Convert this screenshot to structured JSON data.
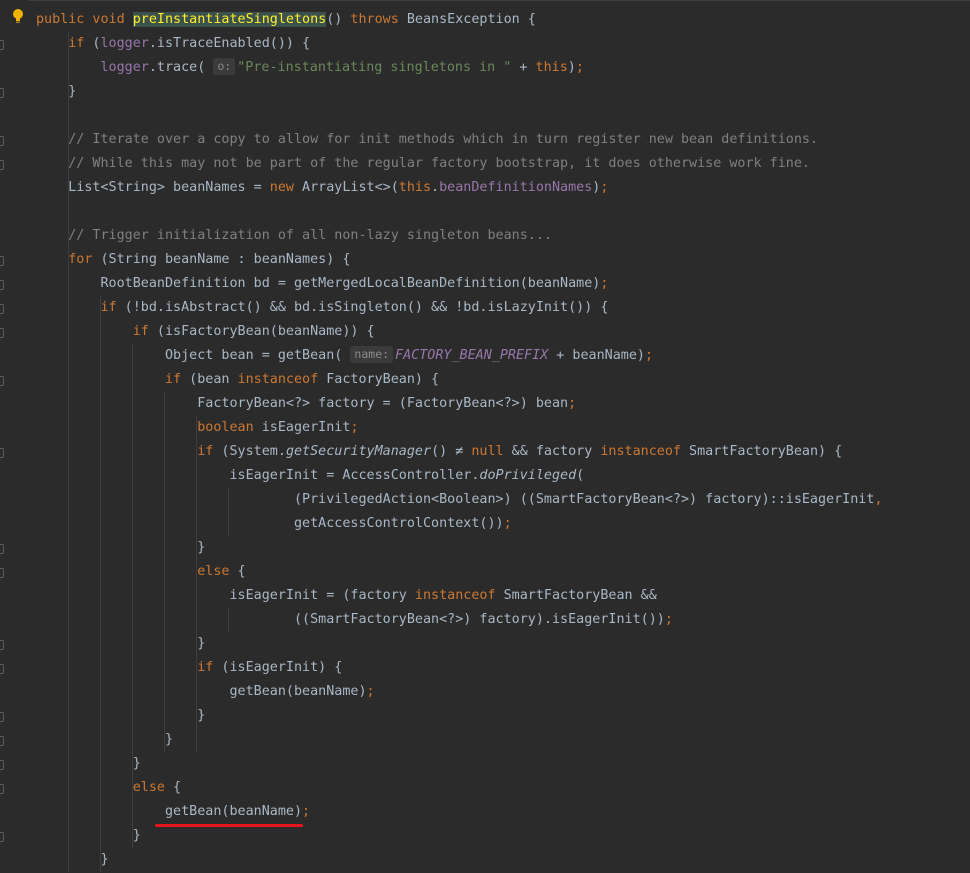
{
  "code_lines": [
    {
      "segments": [
        {
          "text": "public void ",
          "cls": "kw"
        },
        {
          "text": "preInstantiateSingletons",
          "cls": "fn hl"
        },
        {
          "text": "() "
        },
        {
          "text": "throws",
          "cls": "kw"
        },
        {
          "text": " BeansException {"
        }
      ]
    },
    {
      "segments": [
        {
          "text": "    "
        },
        {
          "text": "if",
          "cls": "kw"
        },
        {
          "text": " ("
        },
        {
          "text": "logger",
          "cls": "fld"
        },
        {
          "text": ".isTraceEnabled()) {"
        }
      ]
    },
    {
      "segments": [
        {
          "text": "        "
        },
        {
          "text": "logger",
          "cls": "fld"
        },
        {
          "text": ".trace( "
        },
        {
          "text": "o:",
          "cls": "hint"
        },
        {
          "text": "\"Pre-instantiating singletons in \"",
          "cls": "str"
        },
        {
          "text": " + "
        },
        {
          "text": "this",
          "cls": "kw"
        },
        {
          "text": ")"
        },
        {
          "text": ";",
          "cls": "kw"
        }
      ]
    },
    {
      "segments": [
        {
          "text": "    }"
        }
      ]
    },
    {
      "segments": [
        {
          "text": ""
        }
      ]
    },
    {
      "segments": [
        {
          "text": "    // Iterate over a copy to allow for init methods which in turn register new bean definitions.",
          "cls": "cmt"
        }
      ]
    },
    {
      "segments": [
        {
          "text": "    // While this may not be part of the regular factory bootstrap, it does otherwise work fine.",
          "cls": "cmt"
        }
      ]
    },
    {
      "segments": [
        {
          "text": "    List<String> beanNames = "
        },
        {
          "text": "new",
          "cls": "kw"
        },
        {
          "text": " ArrayList<>("
        },
        {
          "text": "this",
          "cls": "kw"
        },
        {
          "text": "."
        },
        {
          "text": "beanDefinitionNames",
          "cls": "fld"
        },
        {
          "text": ")"
        },
        {
          "text": ";",
          "cls": "kw"
        }
      ]
    },
    {
      "segments": [
        {
          "text": ""
        }
      ]
    },
    {
      "segments": [
        {
          "text": "    // Trigger initialization of all non-lazy singleton beans...",
          "cls": "cmt"
        }
      ]
    },
    {
      "segments": [
        {
          "text": "    "
        },
        {
          "text": "for",
          "cls": "kw"
        },
        {
          "text": " (String beanName : beanNames) {"
        }
      ]
    },
    {
      "segments": [
        {
          "text": "        RootBeanDefinition bd = getMergedLocalBeanDefinition(beanName)"
        },
        {
          "text": ";",
          "cls": "kw"
        }
      ]
    },
    {
      "segments": [
        {
          "text": "        "
        },
        {
          "text": "if",
          "cls": "kw"
        },
        {
          "text": " (!bd.isAbstract() && bd.isSingleton() && !bd.isLazyInit()) {"
        }
      ]
    },
    {
      "segments": [
        {
          "text": "            "
        },
        {
          "text": "if",
          "cls": "kw"
        },
        {
          "text": " (isFactoryBean(beanName)) {"
        }
      ]
    },
    {
      "segments": [
        {
          "text": "                Object bean = getBean( "
        },
        {
          "text": "name:",
          "cls": "hint"
        },
        {
          "text": "FACTORY_BEAN_PREFIX",
          "cls": "cst"
        },
        {
          "text": " + beanName)"
        },
        {
          "text": ";",
          "cls": "kw"
        }
      ]
    },
    {
      "segments": [
        {
          "text": "                "
        },
        {
          "text": "if",
          "cls": "kw"
        },
        {
          "text": " (bean "
        },
        {
          "text": "instanceof",
          "cls": "kw"
        },
        {
          "text": " FactoryBean) {"
        }
      ]
    },
    {
      "segments": [
        {
          "text": "                    FactoryBean<?> factory = (FactoryBean<?>) bean"
        },
        {
          "text": ";",
          "cls": "kw"
        }
      ]
    },
    {
      "segments": [
        {
          "text": "                    "
        },
        {
          "text": "boolean",
          "cls": "kw"
        },
        {
          "text": " isEagerInit"
        },
        {
          "text": ";",
          "cls": "kw"
        }
      ]
    },
    {
      "segments": [
        {
          "text": "                    "
        },
        {
          "text": "if",
          "cls": "kw"
        },
        {
          "text": " (System."
        },
        {
          "text": "getSecurityManager",
          "cls": "it"
        },
        {
          "text": "() ≠ "
        },
        {
          "text": "null",
          "cls": "kw"
        },
        {
          "text": " && factory "
        },
        {
          "text": "instanceof",
          "cls": "kw"
        },
        {
          "text": " SmartFactoryBean) {"
        }
      ]
    },
    {
      "segments": [
        {
          "text": "                        isEagerInit = AccessController."
        },
        {
          "text": "doPrivileged",
          "cls": "it"
        },
        {
          "text": "("
        }
      ]
    },
    {
      "segments": [
        {
          "text": "                                (PrivilegedAction<Boolean>) ((SmartFactoryBean<?>) factory)::isEagerInit"
        },
        {
          "text": ",",
          "cls": "kw"
        }
      ]
    },
    {
      "segments": [
        {
          "text": "                                getAccessControlContext())"
        },
        {
          "text": ";",
          "cls": "kw"
        }
      ]
    },
    {
      "segments": [
        {
          "text": "                    }"
        }
      ]
    },
    {
      "segments": [
        {
          "text": "                    "
        },
        {
          "text": "else",
          "cls": "kw"
        },
        {
          "text": " {"
        }
      ]
    },
    {
      "segments": [
        {
          "text": "                        isEagerInit = (factory "
        },
        {
          "text": "instanceof",
          "cls": "kw"
        },
        {
          "text": " SmartFactoryBean &&"
        }
      ]
    },
    {
      "segments": [
        {
          "text": "                                ((SmartFactoryBean<?>) factory).isEagerInit())"
        },
        {
          "text": ";",
          "cls": "kw"
        }
      ]
    },
    {
      "segments": [
        {
          "text": "                    }"
        }
      ]
    },
    {
      "segments": [
        {
          "text": "                    "
        },
        {
          "text": "if",
          "cls": "kw"
        },
        {
          "text": " (isEagerInit) {"
        }
      ]
    },
    {
      "segments": [
        {
          "text": "                        getBean(beanName)"
        },
        {
          "text": ";",
          "cls": "kw"
        }
      ]
    },
    {
      "segments": [
        {
          "text": "                    }"
        }
      ]
    },
    {
      "segments": [
        {
          "text": "                }"
        }
      ]
    },
    {
      "segments": [
        {
          "text": "            }"
        }
      ]
    },
    {
      "segments": [
        {
          "text": "            "
        },
        {
          "text": "else",
          "cls": "kw"
        },
        {
          "text": " {"
        }
      ]
    },
    {
      "segments": [
        {
          "text": "                getBean(beanName)"
        },
        {
          "text": ";",
          "cls": "kw"
        }
      ]
    },
    {
      "segments": [
        {
          "text": "            }"
        }
      ]
    },
    {
      "segments": [
        {
          "text": "        }"
        }
      ]
    }
  ],
  "colors": {
    "background": "#2b2b2b",
    "keyword": "#cc7832",
    "method_declaration": "#ffc66d",
    "string": "#6a8759",
    "comment": "#808080",
    "field": "#9876aa",
    "default_text": "#a9b7c6",
    "annotation_underline": "#e8141b",
    "intention_bulb": "#f0b400"
  },
  "icons": {
    "gutter_bulb": "lightbulb-icon",
    "fold_markers": "fold-marker-icon"
  }
}
